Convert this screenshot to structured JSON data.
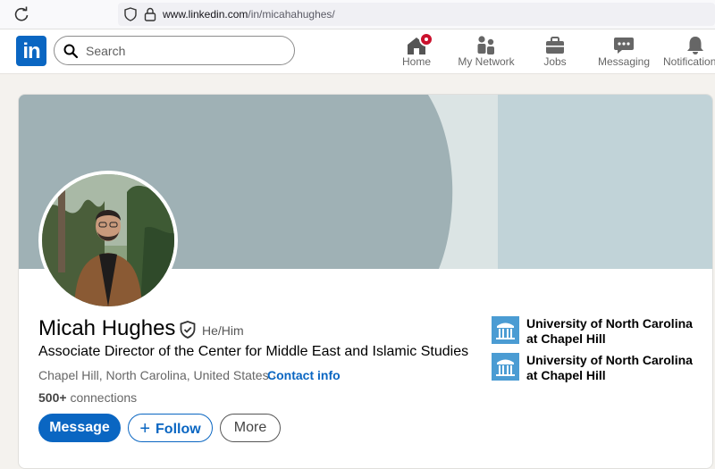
{
  "browser": {
    "url_host": "www.linkedin.com",
    "url_path": "/in/micahahughes/"
  },
  "nav": {
    "logo_text": "in",
    "search_placeholder": "Search",
    "items": [
      {
        "label": "Home",
        "icon": "home-icon"
      },
      {
        "label": "My Network",
        "icon": "network-icon"
      },
      {
        "label": "Jobs",
        "icon": "briefcase-icon"
      },
      {
        "label": "Messaging",
        "icon": "messaging-icon"
      },
      {
        "label": "Notifications",
        "icon": "bell-icon"
      }
    ],
    "home_badge": true
  },
  "profile": {
    "name": "Micah Hughes",
    "pronouns": "He/Him",
    "headline": "Associate Director of the Center for Middle East and Islamic Studies",
    "location": "Chapel Hill, North Carolina, United States",
    "separator": " ·",
    "contact_label": "Contact info",
    "connections_count": "500+",
    "connections_label": "connections",
    "buttons": {
      "message": "Message",
      "follow": "Follow",
      "more": "More"
    },
    "organizations": [
      {
        "name": "University of North Carolina at Chapel Hill",
        "icon": "unc-logo-icon"
      },
      {
        "name": "University of North Carolina at Chapel Hill",
        "icon": "unc-logo-icon"
      }
    ]
  },
  "colors": {
    "brand": "#0a66c2",
    "badge": "#cb112d",
    "banner_dark": "#9fb1b5",
    "banner_light": "#c1d3d8",
    "org_logo": "#4b9cd3"
  }
}
